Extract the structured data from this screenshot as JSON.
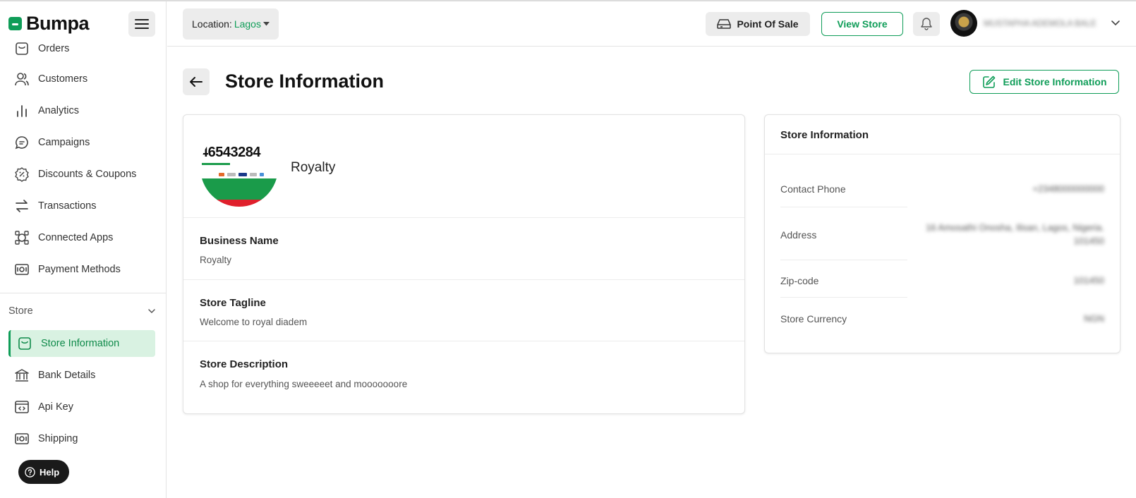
{
  "brand": {
    "name": "Bumpa",
    "accent": "#0f9d58"
  },
  "sidebar": {
    "items": [
      {
        "label": "Orders",
        "icon": "bag-icon"
      },
      {
        "label": "Customers",
        "icon": "users-icon"
      },
      {
        "label": "Analytics",
        "icon": "bar-chart-icon"
      },
      {
        "label": "Campaigns",
        "icon": "chat-icon"
      },
      {
        "label": "Discounts & Coupons",
        "icon": "discount-icon"
      },
      {
        "label": "Transactions",
        "icon": "transfer-icon"
      },
      {
        "label": "Connected Apps",
        "icon": "connected-apps-icon"
      },
      {
        "label": "Payment Methods",
        "icon": "cash-icon"
      }
    ],
    "section_label": "Store",
    "store_items": [
      {
        "label": "Store Information",
        "icon": "bag-icon",
        "active": true
      },
      {
        "label": "Bank Details",
        "icon": "bank-icon"
      },
      {
        "label": "Api Key",
        "icon": "code-window-icon"
      },
      {
        "label": "Shipping",
        "icon": "cash-icon"
      }
    ],
    "help_label": "Help"
  },
  "header": {
    "location_label": "Location:",
    "location_value": "Lagos",
    "pos_label": "Point Of Sale",
    "view_store_label": "View Store",
    "user_name": "MUSTAPHA ADEMOLA BALE"
  },
  "page": {
    "title": "Store Information",
    "edit_label": "Edit Store Information"
  },
  "store": {
    "logo_text": "46543284",
    "display_name": "Royalty",
    "fields": [
      {
        "label": "Business Name",
        "value": "Royalty"
      },
      {
        "label": "Store Tagline",
        "value": "Welcome to royal diadem"
      },
      {
        "label": "Store Description",
        "value": "A shop for everything sweeeeet and mooooooore"
      }
    ]
  },
  "info_card": {
    "title": "Store Information",
    "rows": [
      {
        "label": "Contact Phone",
        "value": "+2348000000000"
      },
      {
        "label": "Address",
        "value": "16 Amosathi Onosha, Ilisan, Lagos, Nigeria.",
        "value2": "101450"
      },
      {
        "label": "Zip-code",
        "value": "101450"
      },
      {
        "label": "Store Currency",
        "value": "NGN"
      }
    ]
  }
}
